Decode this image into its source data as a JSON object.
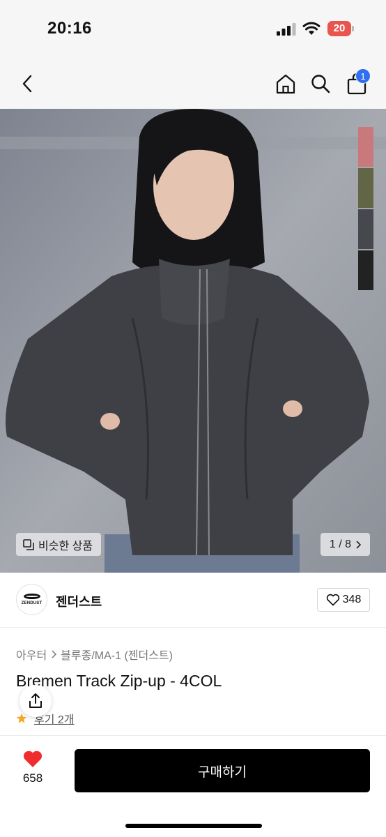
{
  "status_bar": {
    "time": "20:16",
    "battery": "20"
  },
  "nav": {
    "back_icon": "chevron-left-icon",
    "home_icon": "home-icon",
    "search_icon": "search-icon",
    "cart_icon": "shopping-bag-icon",
    "cart_badge": "1",
    "badge_color": "#2f6ff0"
  },
  "hero": {
    "color_swatches": [
      "#c9787c",
      "#636547",
      "#47484d",
      "#222222"
    ],
    "similar_label": "비슷한 상품",
    "page_indicator": "1 / 8"
  },
  "brand": {
    "logo_text": "ZENDUST",
    "name": "젠더스트",
    "like_count": "348"
  },
  "product": {
    "breadcrumb": [
      "아우터",
      "블루종/MA-1 (젠더스트)"
    ],
    "title": "Bremen Track Zip-up - 4COL",
    "review_link": "후기 2개"
  },
  "bottom_bar": {
    "wish_count": "658",
    "buy_label": "구매하기",
    "heart_color": "#ef2d2d"
  }
}
